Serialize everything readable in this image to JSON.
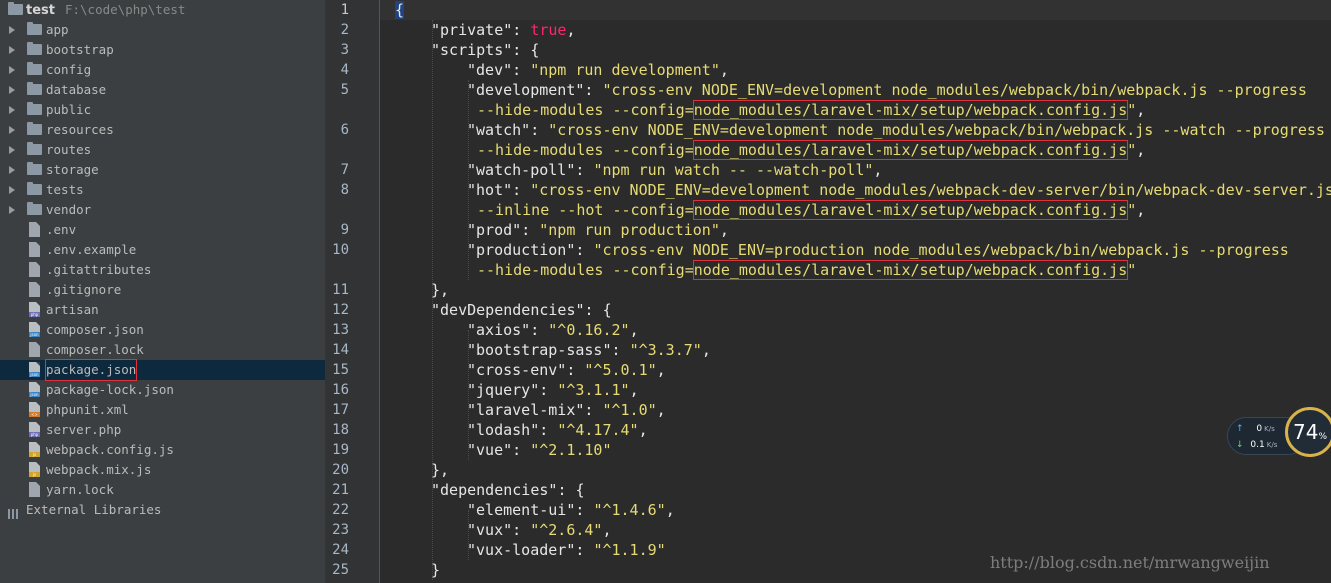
{
  "project": {
    "name": "test",
    "path": "F:\\code\\php\\test",
    "folders": [
      "app",
      "bootstrap",
      "config",
      "database",
      "public",
      "resources",
      "routes",
      "storage",
      "tests",
      "vendor"
    ],
    "files": [
      {
        "name": ".env",
        "badge": "",
        "color": "#9fa6ad"
      },
      {
        "name": ".env.example",
        "badge": "",
        "color": "#9fa6ad"
      },
      {
        "name": ".gitattributes",
        "badge": "",
        "color": "#9fa6ad"
      },
      {
        "name": ".gitignore",
        "badge": "",
        "color": "#9fa6ad"
      },
      {
        "name": "artisan",
        "badge": "php",
        "color": "#6f6fb4"
      },
      {
        "name": "composer.json",
        "badge": "json",
        "color": "#3c83c4"
      },
      {
        "name": "composer.lock",
        "badge": "",
        "color": "#9fa6ad"
      },
      {
        "name": "package.json",
        "badge": "json",
        "color": "#3c83c4",
        "selected": true
      },
      {
        "name": "package-lock.json",
        "badge": "json",
        "color": "#3c83c4"
      },
      {
        "name": "phpunit.xml",
        "badge": "<>",
        "color": "#d27a2a"
      },
      {
        "name": "server.php",
        "badge": "php",
        "color": "#6f6fb4"
      },
      {
        "name": "webpack.config.js",
        "badge": "js",
        "color": "#d2a62a"
      },
      {
        "name": "webpack.mix.js",
        "badge": "js",
        "color": "#d2a62a"
      },
      {
        "name": "yarn.lock",
        "badge": "",
        "color": "#9fa6ad"
      }
    ],
    "external_libraries": "External Libraries"
  },
  "line_numbers": [
    "1",
    "2",
    "3",
    "4",
    "5",
    "",
    "6",
    "",
    "7",
    "8",
    "",
    "9",
    "10",
    "",
    "11",
    "12",
    "13",
    "14",
    "15",
    "16",
    "17",
    "18",
    "19",
    "20",
    "21",
    "22",
    "23",
    "24",
    "25"
  ],
  "code_rows": [
    {
      "indent": 0,
      "parts": [
        {
          "t": "{",
          "c": "p cursor-bracket"
        }
      ]
    },
    {
      "indent": 1,
      "parts": [
        {
          "t": "\"private\"",
          "c": "k"
        },
        {
          "t": ": ",
          "c": "p"
        },
        {
          "t": "true",
          "c": "b"
        },
        {
          "t": ",",
          "c": "p"
        }
      ]
    },
    {
      "indent": 1,
      "parts": [
        {
          "t": "\"scripts\"",
          "c": "k"
        },
        {
          "t": ": {",
          "c": "p"
        }
      ]
    },
    {
      "indent": 2,
      "parts": [
        {
          "t": "\"dev\"",
          "c": "k"
        },
        {
          "t": ": ",
          "c": "p"
        },
        {
          "t": "\"npm run development\"",
          "c": "s"
        },
        {
          "t": ",",
          "c": "p"
        }
      ]
    },
    {
      "indent": 2,
      "parts": [
        {
          "t": "\"development\"",
          "c": "k"
        },
        {
          "t": ": ",
          "c": "p"
        },
        {
          "t": "\"cross-env NODE_ENV=development node_modules/webpack/bin/webpack.js --progress",
          "c": "s"
        }
      ]
    },
    {
      "indent": 2,
      "cont": true,
      "parts": [
        {
          "t": "--hide-modules --config=",
          "c": "s"
        },
        {
          "t": "node_modules/laravel-mix/setup/webpack.config.js",
          "c": "s hl"
        },
        {
          "t": "\"",
          "c": "s"
        },
        {
          "t": ",",
          "c": "p"
        }
      ]
    },
    {
      "indent": 2,
      "parts": [
        {
          "t": "\"watch\"",
          "c": "k"
        },
        {
          "t": ": ",
          "c": "p"
        },
        {
          "t": "\"cross-env NODE_ENV=development node_modules/webpack/bin/webpack.js --watch --progress",
          "c": "s"
        }
      ]
    },
    {
      "indent": 2,
      "cont": true,
      "parts": [
        {
          "t": "--hide-modules --config=",
          "c": "s"
        },
        {
          "t": "node_modules/laravel-mix/setup/webpack.config.js",
          "c": "s hl"
        },
        {
          "t": "\"",
          "c": "s"
        },
        {
          "t": ",",
          "c": "p"
        }
      ]
    },
    {
      "indent": 2,
      "parts": [
        {
          "t": "\"watch-poll\"",
          "c": "k"
        },
        {
          "t": ": ",
          "c": "p"
        },
        {
          "t": "\"npm run watch -- --watch-poll\"",
          "c": "s"
        },
        {
          "t": ",",
          "c": "p"
        }
      ]
    },
    {
      "indent": 2,
      "parts": [
        {
          "t": "\"hot\"",
          "c": "k"
        },
        {
          "t": ": ",
          "c": "p"
        },
        {
          "t": "\"cross-env NODE_ENV=development node_modules/webpack-dev-server/bin/webpack-dev-server.js",
          "c": "s"
        }
      ]
    },
    {
      "indent": 2,
      "cont": true,
      "parts": [
        {
          "t": "--inline --hot --config=",
          "c": "s"
        },
        {
          "t": "node_modules/laravel-mix/setup/webpack.config.js",
          "c": "s hl"
        },
        {
          "t": "\"",
          "c": "s"
        },
        {
          "t": ",",
          "c": "p"
        }
      ]
    },
    {
      "indent": 2,
      "parts": [
        {
          "t": "\"prod\"",
          "c": "k"
        },
        {
          "t": ": ",
          "c": "p"
        },
        {
          "t": "\"npm run production\"",
          "c": "s"
        },
        {
          "t": ",",
          "c": "p"
        }
      ]
    },
    {
      "indent": 2,
      "parts": [
        {
          "t": "\"production\"",
          "c": "k"
        },
        {
          "t": ": ",
          "c": "p"
        },
        {
          "t": "\"cross-env NODE_ENV=production node_modules/webpack/bin/webpack.js --progress",
          "c": "s"
        }
      ]
    },
    {
      "indent": 2,
      "cont": true,
      "parts": [
        {
          "t": "--hide-modules --config=",
          "c": "s"
        },
        {
          "t": "node_modules/laravel-mix/setup/webpack.config.js",
          "c": "s hl"
        },
        {
          "t": "\"",
          "c": "s"
        }
      ]
    },
    {
      "indent": 1,
      "parts": [
        {
          "t": "},",
          "c": "p"
        }
      ]
    },
    {
      "indent": 1,
      "parts": [
        {
          "t": "\"devDependencies\"",
          "c": "k"
        },
        {
          "t": ": {",
          "c": "p"
        }
      ]
    },
    {
      "indent": 2,
      "parts": [
        {
          "t": "\"axios\"",
          "c": "k"
        },
        {
          "t": ": ",
          "c": "p"
        },
        {
          "t": "\"^0.16.2\"",
          "c": "s"
        },
        {
          "t": ",",
          "c": "p"
        }
      ]
    },
    {
      "indent": 2,
      "parts": [
        {
          "t": "\"bootstrap-sass\"",
          "c": "k"
        },
        {
          "t": ": ",
          "c": "p"
        },
        {
          "t": "\"^3.3.7\"",
          "c": "s"
        },
        {
          "t": ",",
          "c": "p"
        }
      ]
    },
    {
      "indent": 2,
      "parts": [
        {
          "t": "\"cross-env\"",
          "c": "k"
        },
        {
          "t": ": ",
          "c": "p"
        },
        {
          "t": "\"^5.0.1\"",
          "c": "s"
        },
        {
          "t": ",",
          "c": "p"
        }
      ]
    },
    {
      "indent": 2,
      "parts": [
        {
          "t": "\"jquery\"",
          "c": "k"
        },
        {
          "t": ": ",
          "c": "p"
        },
        {
          "t": "\"^3.1.1\"",
          "c": "s"
        },
        {
          "t": ",",
          "c": "p"
        }
      ]
    },
    {
      "indent": 2,
      "parts": [
        {
          "t": "\"laravel-mix\"",
          "c": "k"
        },
        {
          "t": ": ",
          "c": "p"
        },
        {
          "t": "\"^1.0\"",
          "c": "s"
        },
        {
          "t": ",",
          "c": "p"
        }
      ]
    },
    {
      "indent": 2,
      "parts": [
        {
          "t": "\"lodash\"",
          "c": "k"
        },
        {
          "t": ": ",
          "c": "p"
        },
        {
          "t": "\"^4.17.4\"",
          "c": "s"
        },
        {
          "t": ",",
          "c": "p"
        }
      ]
    },
    {
      "indent": 2,
      "parts": [
        {
          "t": "\"vue\"",
          "c": "k"
        },
        {
          "t": ": ",
          "c": "p"
        },
        {
          "t": "\"^2.1.10\"",
          "c": "s"
        }
      ]
    },
    {
      "indent": 1,
      "parts": [
        {
          "t": "},",
          "c": "p"
        }
      ]
    },
    {
      "indent": 1,
      "parts": [
        {
          "t": "\"dependencies\"",
          "c": "k"
        },
        {
          "t": ": {",
          "c": "p"
        }
      ]
    },
    {
      "indent": 2,
      "parts": [
        {
          "t": "\"element-ui\"",
          "c": "k"
        },
        {
          "t": ": ",
          "c": "p"
        },
        {
          "t": "\"^1.4.6\"",
          "c": "s"
        },
        {
          "t": ",",
          "c": "p"
        }
      ]
    },
    {
      "indent": 2,
      "parts": [
        {
          "t": "\"vux\"",
          "c": "k"
        },
        {
          "t": ": ",
          "c": "p"
        },
        {
          "t": "\"^2.6.4\"",
          "c": "s"
        },
        {
          "t": ",",
          "c": "p"
        }
      ]
    },
    {
      "indent": 2,
      "parts": [
        {
          "t": "\"vux-loader\"",
          "c": "k"
        },
        {
          "t": ": ",
          "c": "p"
        },
        {
          "t": "\"^1.1.9\"",
          "c": "s"
        }
      ]
    },
    {
      "indent": 1,
      "parts": [
        {
          "t": "}",
          "c": "p"
        }
      ]
    }
  ],
  "net_widget": {
    "upload": "0",
    "upload_unit": "K/s",
    "download": "0.1",
    "download_unit": "K/s",
    "usage": "74",
    "usage_unit": "%"
  },
  "watermark": "http://blog.csdn.net/mrwangweijin"
}
